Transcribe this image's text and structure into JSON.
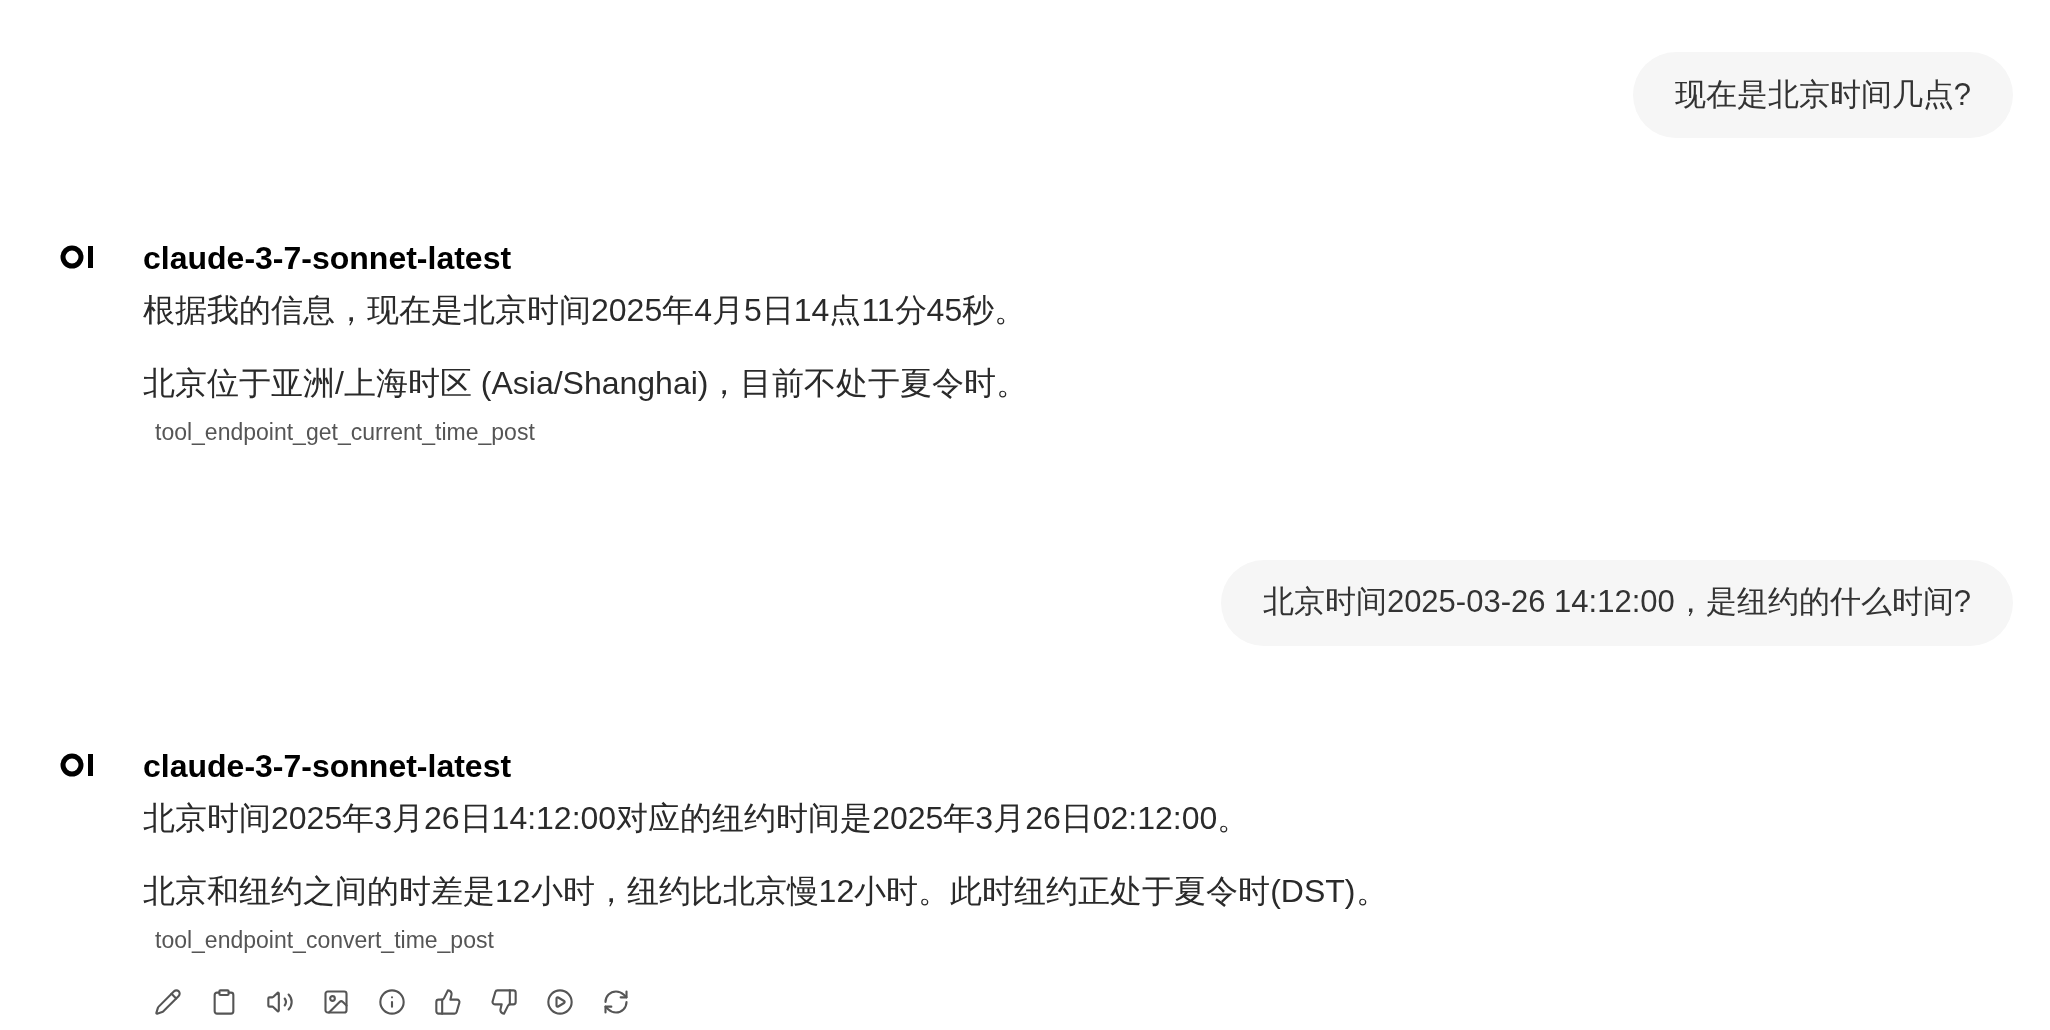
{
  "messages": [
    {
      "kind": "user",
      "text": "现在是北京时间几点?"
    },
    {
      "kind": "assistant",
      "model": "claude-3-7-sonnet-latest",
      "paragraphs": [
        "根据我的信息，现在是北京时间2025年4月5日14点11分45秒。",
        "北京位于亚洲/上海时区 (Asia/Shanghai)，目前不处于夏令时。"
      ],
      "tool": "tool_endpoint_get_current_time_post",
      "show_actions": false
    },
    {
      "kind": "user",
      "text": "北京时间2025-03-26 14:12:00，是纽约的什么时间?"
    },
    {
      "kind": "assistant",
      "model": "claude-3-7-sonnet-latest",
      "paragraphs": [
        "北京时间2025年3月26日14:12:00对应的纽约时间是2025年3月26日02:12:00。",
        "北京和纽约之间的时差是12小时，纽约比北京慢12小时。此时纽约正处于夏令时(DST)。"
      ],
      "tool": "tool_endpoint_convert_time_post",
      "show_actions": true
    }
  ]
}
